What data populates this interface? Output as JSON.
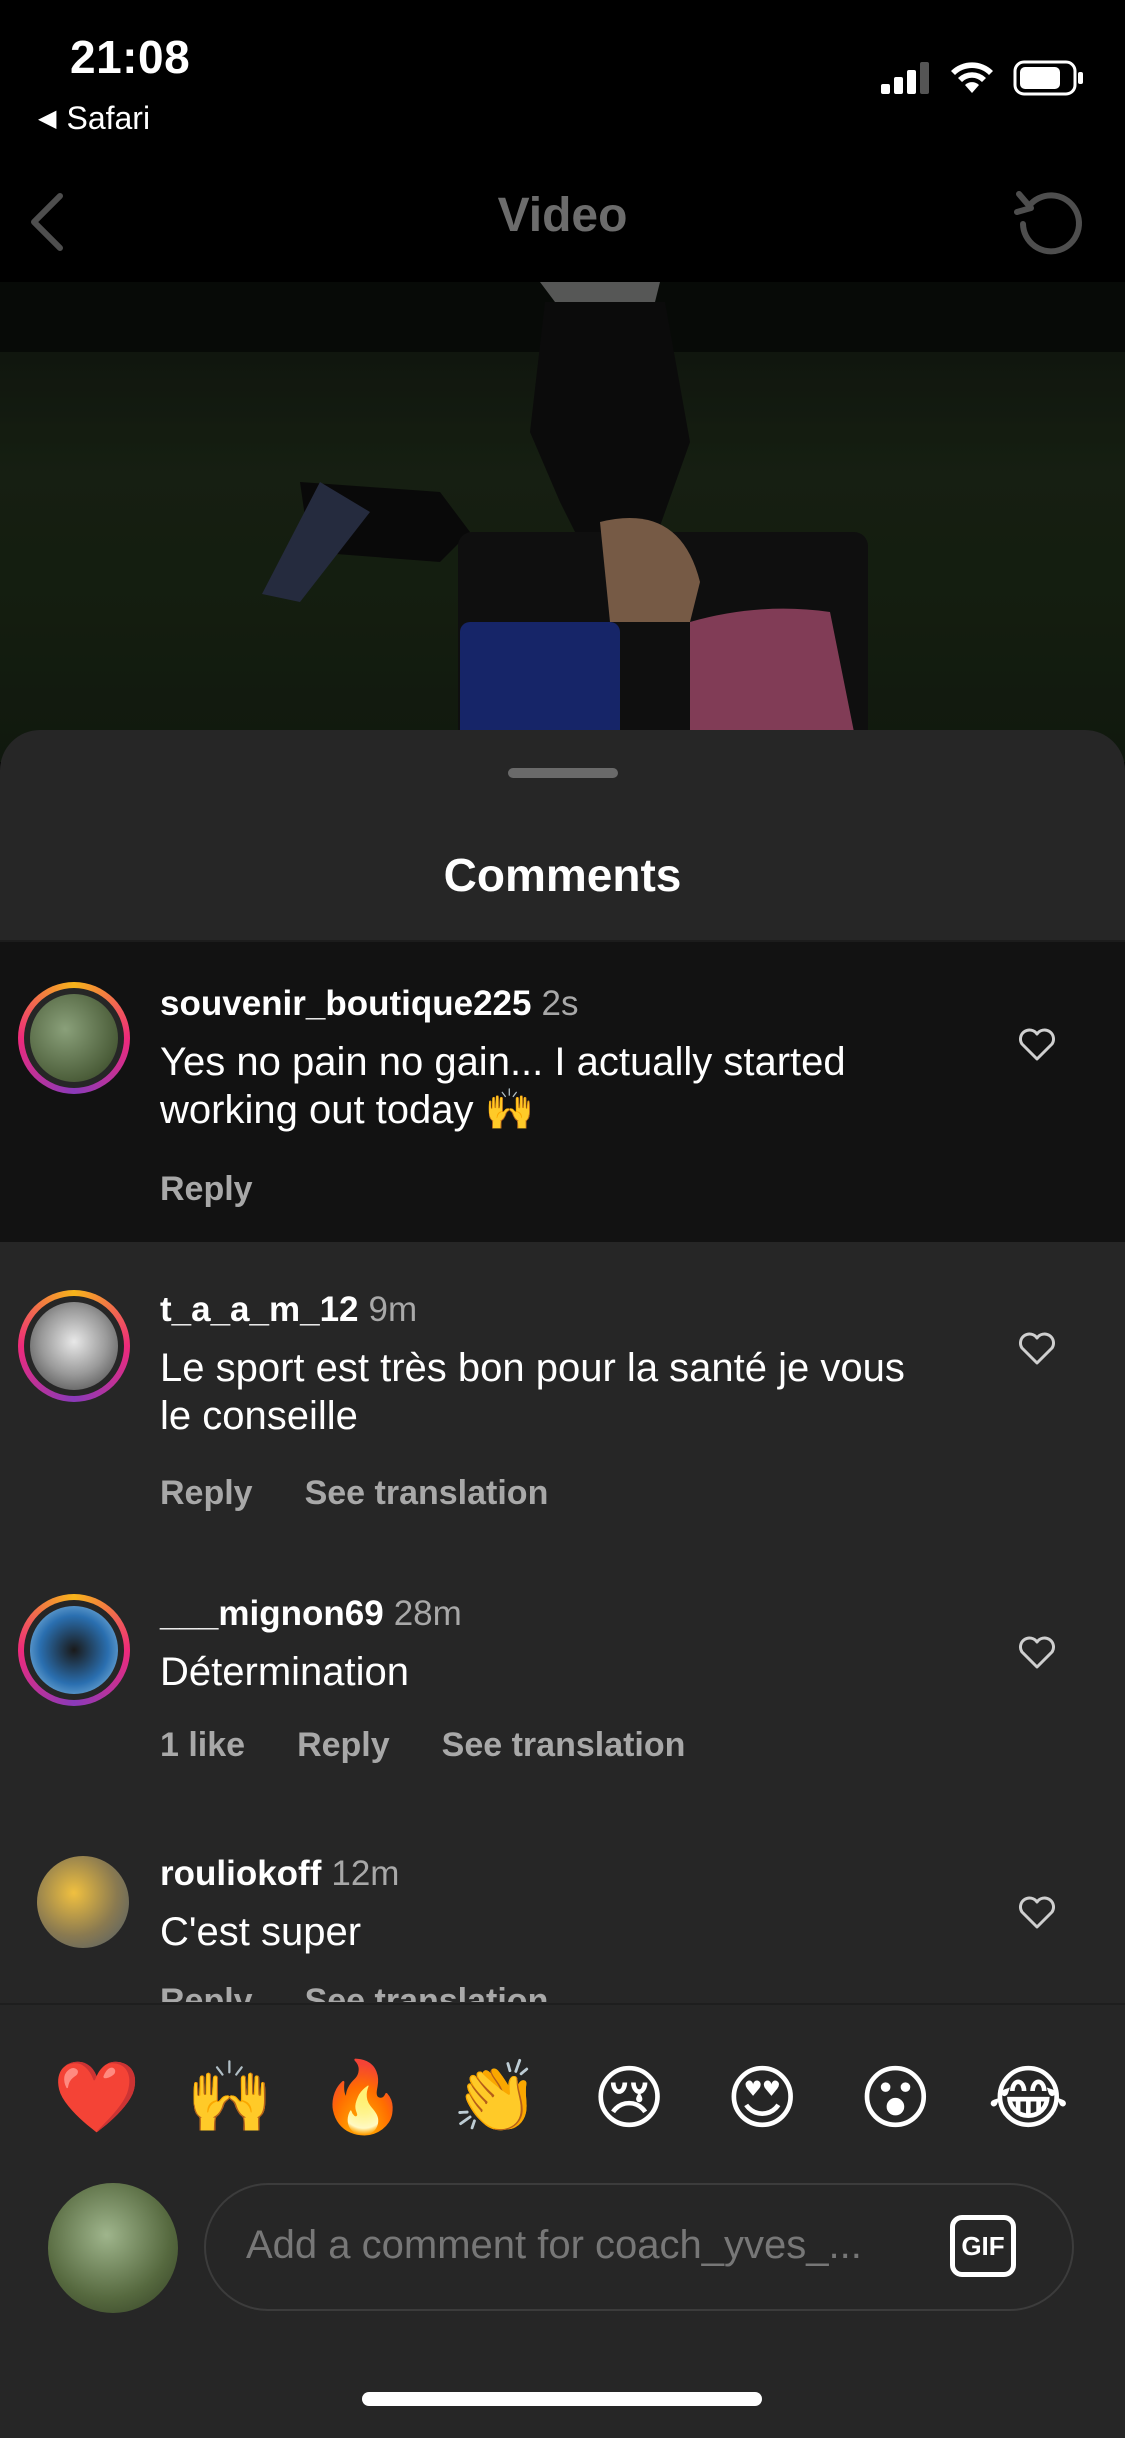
{
  "status_bar": {
    "time": "21:08",
    "back_app": "Safari"
  },
  "nav": {
    "title": "Video"
  },
  "sheet": {
    "title": "Comments"
  },
  "comments": [
    {
      "user": "souvenir_boutique225",
      "time": "2s",
      "text": "Yes no pain no gain... I actually started working out today 🙌",
      "actions": [
        "Reply"
      ]
    },
    {
      "user": "t_a_a_m_12",
      "time": "9m",
      "text": "Le sport est très bon pour la santé je vous le conseille",
      "actions": [
        "Reply",
        "See translation"
      ]
    },
    {
      "user": "___mignon69",
      "time": "28m",
      "text": "Détermination",
      "actions": [
        "1 like",
        "Reply",
        "See translation"
      ]
    },
    {
      "user": "rouliokoff",
      "time": "12m",
      "text": "C'est super",
      "actions": [
        "Reply",
        "See translation"
      ]
    }
  ],
  "quick_reactions": [
    "❤️",
    "🙌",
    "🔥",
    "👏",
    "😢",
    "😍",
    "😮",
    "😂"
  ],
  "input": {
    "placeholder": "Add a comment for coach_yves_...",
    "gif_label": "GIF"
  },
  "colors": {
    "background": "#000000",
    "sheet": "#262626",
    "highlight_row": "#121212",
    "secondary_text": "#a8a8a8"
  }
}
